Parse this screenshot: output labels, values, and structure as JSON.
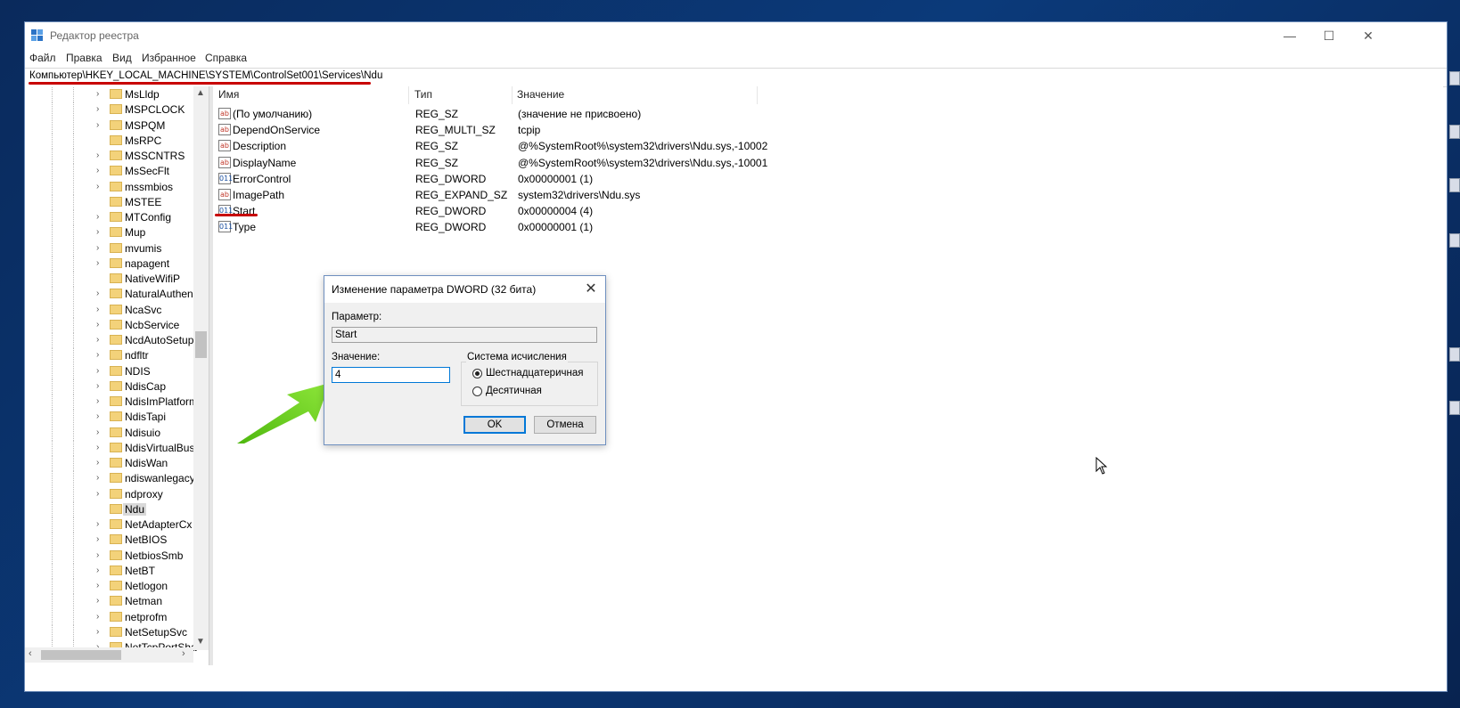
{
  "window": {
    "title": "Редактор реестра",
    "controls": {
      "minimize": "—",
      "maximize": "☐",
      "close": "✕"
    }
  },
  "menu": [
    "Файл",
    "Правка",
    "Вид",
    "Избранное",
    "Справка"
  ],
  "address": "Компьютер\\HKEY_LOCAL_MACHINE\\SYSTEM\\ControlSet001\\Services\\Ndu",
  "tree": {
    "items": [
      {
        "label": "MsLldp",
        "expandable": true
      },
      {
        "label": "MSPCLOCK",
        "expandable": true
      },
      {
        "label": "MSPQM",
        "expandable": true
      },
      {
        "label": "MsRPC",
        "expandable": false
      },
      {
        "label": "MSSCNTRS",
        "expandable": true
      },
      {
        "label": "MsSecFlt",
        "expandable": true
      },
      {
        "label": "mssmbios",
        "expandable": true
      },
      {
        "label": "MSTEE",
        "expandable": false
      },
      {
        "label": "MTConfig",
        "expandable": true
      },
      {
        "label": "Mup",
        "expandable": true
      },
      {
        "label": "mvumis",
        "expandable": true
      },
      {
        "label": "napagent",
        "expandable": true
      },
      {
        "label": "NativeWifiP",
        "expandable": false
      },
      {
        "label": "NaturalAuthen",
        "expandable": true
      },
      {
        "label": "NcaSvc",
        "expandable": true
      },
      {
        "label": "NcbService",
        "expandable": true
      },
      {
        "label": "NcdAutoSetup",
        "expandable": true
      },
      {
        "label": "ndfltr",
        "expandable": true
      },
      {
        "label": "NDIS",
        "expandable": true
      },
      {
        "label": "NdisCap",
        "expandable": true
      },
      {
        "label": "NdisImPlatform",
        "expandable": true
      },
      {
        "label": "NdisTapi",
        "expandable": true
      },
      {
        "label": "Ndisuio",
        "expandable": true
      },
      {
        "label": "NdisVirtualBus",
        "expandable": true
      },
      {
        "label": "NdisWan",
        "expandable": true
      },
      {
        "label": "ndiswanlegacy",
        "expandable": true
      },
      {
        "label": "ndproxy",
        "expandable": true
      },
      {
        "label": "Ndu",
        "expandable": false,
        "selected": true
      },
      {
        "label": "NetAdapterCx",
        "expandable": true
      },
      {
        "label": "NetBIOS",
        "expandable": true
      },
      {
        "label": "NetbiosSmb",
        "expandable": true
      },
      {
        "label": "NetBT",
        "expandable": true
      },
      {
        "label": "Netlogon",
        "expandable": true
      },
      {
        "label": "Netman",
        "expandable": true
      },
      {
        "label": "netprofm",
        "expandable": true
      },
      {
        "label": "NetSetupSvc",
        "expandable": true
      },
      {
        "label": "NetTcpPortSha",
        "expandable": true
      }
    ]
  },
  "columns": {
    "name": "Имя",
    "type": "Тип",
    "value": "Значение"
  },
  "values": [
    {
      "icon": "ab",
      "name": "(По умолчанию)",
      "type": "REG_SZ",
      "data": "(значение не присвоено)"
    },
    {
      "icon": "ab",
      "name": "DependOnService",
      "type": "REG_MULTI_SZ",
      "data": "tcpip"
    },
    {
      "icon": "ab",
      "name": "Description",
      "type": "REG_SZ",
      "data": "@%SystemRoot%\\system32\\drivers\\Ndu.sys,-10002"
    },
    {
      "icon": "ab",
      "name": "DisplayName",
      "type": "REG_SZ",
      "data": "@%SystemRoot%\\system32\\drivers\\Ndu.sys,-10001"
    },
    {
      "icon": "011",
      "name": "ErrorControl",
      "type": "REG_DWORD",
      "data": "0x00000001 (1)"
    },
    {
      "icon": "ab",
      "name": "ImagePath",
      "type": "REG_EXPAND_SZ",
      "data": "system32\\drivers\\Ndu.sys"
    },
    {
      "icon": "011",
      "name": "Start",
      "type": "REG_DWORD",
      "data": "0x00000004 (4)"
    },
    {
      "icon": "011",
      "name": "Type",
      "type": "REG_DWORD",
      "data": "0x00000001 (1)"
    }
  ],
  "dialog": {
    "title": "Изменение параметра DWORD (32 бита)",
    "param_label": "Параметр:",
    "param_value": "Start",
    "value_label": "Значение:",
    "value": "4",
    "base_group": "Система исчисления",
    "hex_label": "Шестнадцатеричная",
    "dec_label": "Десятичная",
    "hex_selected": true,
    "ok": "OK",
    "cancel": "Отмена"
  },
  "colors": {
    "annotation_red": "#c80000",
    "arrow_green": "#6fd21e",
    "accent_blue": "#0078d7"
  }
}
